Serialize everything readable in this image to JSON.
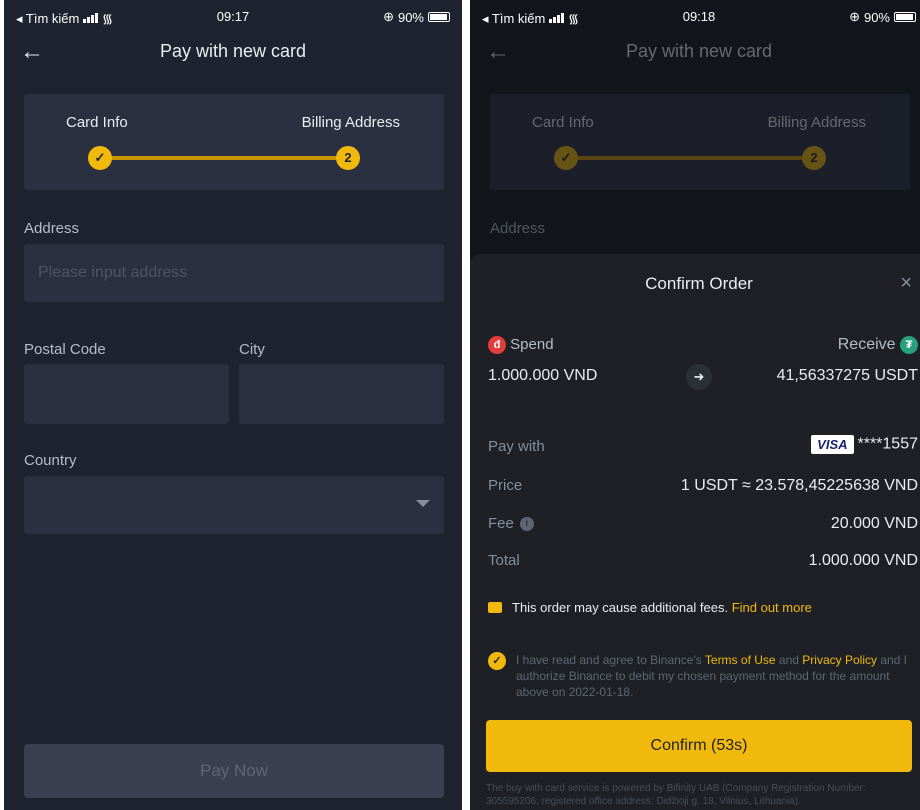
{
  "left": {
    "status": {
      "carrier": "◂ Tìm kiếm",
      "time": "09:17",
      "battery": "90%"
    },
    "nav": {
      "back": "←",
      "title": "Pay with new card"
    },
    "stepper": {
      "step1": "Card Info",
      "step2": "Billing Address",
      "step1_mark": "✓",
      "step2_mark": "2"
    },
    "form": {
      "address_label": "Address",
      "address_placeholder": "Please input address",
      "postal_label": "Postal Code",
      "city_label": "City",
      "country_label": "Country"
    },
    "pay_now": "Pay Now"
  },
  "right": {
    "status": {
      "carrier": "◂ Tìm kiếm",
      "time": "09:18",
      "battery": "90%"
    },
    "nav": {
      "back": "←",
      "title": "Pay with new card"
    },
    "stepper": {
      "step1": "Card Info",
      "step2": "Billing Address",
      "step1_mark": "✓",
      "step2_mark": "2"
    },
    "address_label": "Address",
    "sheet": {
      "title": "Confirm Order",
      "close": "×",
      "spend_label": "Spend",
      "spend_amount": "1.000.000 VND",
      "receive_label": "Receive",
      "receive_amount": "41,56337275 USDT",
      "pay_with_label": "Pay with",
      "card_brand": "VISA",
      "card_number": "****1557",
      "price_label": "Price",
      "price_value": "1 USDT ≈ 23.578,45225638 VND",
      "fee_label": "Fee",
      "fee_value": "20.000 VND",
      "total_label": "Total",
      "total_value": "1.000.000 VND",
      "warning_text": "This order may cause additional fees.",
      "warning_link": "Find out more",
      "agree_1": "I have read and agree to Binance's",
      "terms": "Terms of Use",
      "and": "and",
      "privacy": "Privacy Policy",
      "agree_2": "and I authorize Binance to debit my chosen payment method for the amount above on 2022-01-18.",
      "confirm": "Confirm (53s)",
      "footnote": "The buy with card service is powered by Bifinity UAB (Company Registration Number: 305595206, registered office address: Didžioji g. 18, Vilnius, Lithuania)."
    }
  },
  "colors": {
    "accent": "#f0b90b",
    "bg": "#1f2330",
    "panel": "#2b3040"
  }
}
